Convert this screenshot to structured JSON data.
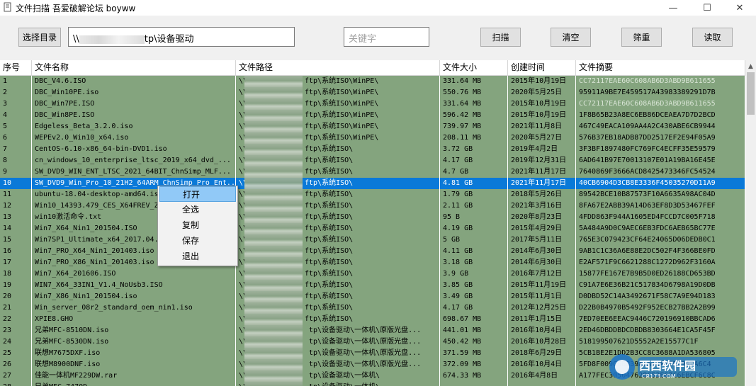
{
  "window": {
    "title": "文件扫描  吾爱破解论坛  boyww",
    "minimize": "—",
    "maximize": "☐",
    "close": "✕"
  },
  "toolbar": {
    "select_dir": "选择目录",
    "path_prefix": "\\\\",
    "path_suffix": "tp\\设备驱动",
    "keyword_placeholder": "关键字",
    "scan": "扫描",
    "clear": "清空",
    "filter": "筛重",
    "read": "读取"
  },
  "table": {
    "headers": [
      "序号",
      "文件名称",
      "文件路径",
      "文件大小",
      "创建时间",
      "文件摘要"
    ],
    "selected_index": 9,
    "rows": [
      [
        "1",
        "DBC_V4.6.ISO",
        "\\\\",
        "ftp\\系统ISO\\WinPE\\",
        "331.64 MB",
        "2015年10月19日",
        "CC72117EAE60C608AB6D3ABD9B611655"
      ],
      [
        "2",
        "DBC_Win10PE.iso",
        "\\\\",
        "ftp\\系统ISO\\WinPE\\",
        "550.76 MB",
        "2020年5月25日",
        "95911A9BE7E459517A43983389291D7B"
      ],
      [
        "3",
        "DBC_Win7PE.ISO",
        "\\\\",
        "ftp\\系统ISO\\WinPE\\",
        "331.64 MB",
        "2015年10月19日",
        "CC72117EAE60C608AB6D3ABD9B611655"
      ],
      [
        "4",
        "DBC_Win8PE.ISO",
        "\\\\",
        "ftp\\系统ISO\\WinPE\\",
        "596.42 MB",
        "2015年10月19日",
        "1F8B65B23A8EC6EB86DCEAEA7D7D2BCD"
      ],
      [
        "5",
        "Edgeless_Beta_3.2.0.iso",
        "\\\\",
        "ftp\\系统ISO\\WinPE\\",
        "739.97 MB",
        "2021年11月8日",
        "467C49EACA109AA4A2C430ABE6CB9944"
      ],
      [
        "6",
        "WEPEv2.0_Win10_x64.iso",
        "\\\\",
        "ftp\\系统ISO\\WinPE\\",
        "208.11 MB",
        "2020年5月27日",
        "576B37EB18ADB87DD2517EF2E94F05A9"
      ],
      [
        "7",
        "CentOS-6.10-x86_64-bin-DVD1.iso",
        "\\\\",
        "ftp\\系统ISO\\",
        "3.72 GB",
        "2019年4月2日",
        "3F3BF1897480FC769FC4ECFF35E59579"
      ],
      [
        "8",
        "cn_windows_10_enterprise_ltsc_2019_x64_dvd_...",
        "\\\\",
        "ftp\\系统ISO\\",
        "4.17 GB",
        "2019年12月31日",
        "6AD641B97E70013107E01A19BA16E45E"
      ],
      [
        "9",
        "SW_DVD9_WIN_ENT_LTSC_2021_64BIT_ChnSimp_MLF...",
        "\\\\",
        "ftp\\系统ISO\\",
        "4.7 GB",
        "2021年11月17日",
        "7640869F3666ACD8425473346FC54524"
      ],
      [
        "10",
        "SW_DVD9_Win_Pro_10_21H2_64ARM_ChnSimp_Pro_Ent...",
        "\\\\",
        "ftp\\系统ISO\\",
        "4.81 GB",
        "2021年11月17日",
        "40CB6904D3CB8E3336F45035270D11A9"
      ],
      [
        "11",
        "ubuntu-18.04-desktop-amd64.iso",
        "\\\\",
        "ftp\\系统ISO\\",
        "1.79 GB",
        "2018年5月26日",
        "89542BCE10B87573F10A6635A98AC04D"
      ],
      [
        "12",
        "Win10_14393.479_CES_X64FREV_ZH-CN.iso",
        "\\\\",
        "ftp\\系统ISO\\",
        "2.11 GB",
        "2021年3月16日",
        "8FA67E2ABB39A14D63EF8D3D53467FEF"
      ],
      [
        "13",
        "win10激活命令.txt",
        "\\\\",
        "ftp\\系统ISO\\",
        "95 B",
        "2020年8月23日",
        "4FDD863F944A1605ED4FCCD7C005F718"
      ],
      [
        "14",
        "Win7_X64_Nin1_201504.ISO",
        "\\\\",
        "ftp\\系统ISO\\",
        "4.19 GB",
        "2015年4月29日",
        "5A484A9D0C9AEC6EB3FDC6AEB65BC77E"
      ],
      [
        "15",
        "Win7SP1_Ultimate_x64_2017.04.iso",
        "\\\\",
        "ftp\\系统ISO\\",
        "5 GB",
        "2017年5月11日",
        "765E3C079423CF64E24065D06DEDB0C1"
      ],
      [
        "16",
        "Win7_PRO_X64_Nin1_201403.iso",
        "\\\\",
        "ftp\\系统ISO\\",
        "4.11 GB",
        "2014年6月30日",
        "9AB1C1C36A6E88E2DC502F4F366BE0FD"
      ],
      [
        "17",
        "Win7_PRO_X86_Nin1_201403.iso",
        "\\\\",
        "ftp\\系统ISO\\",
        "3.18 GB",
        "2014年6月30日",
        "E2AF571F9C6621288C1272D962F3160A"
      ],
      [
        "18",
        "Win7_X64_201606.ISO",
        "\\\\",
        "ftp\\系统ISO\\",
        "3.9 GB",
        "2016年7月12日",
        "15877FE167E7B9B5D0ED26188CD653BD"
      ],
      [
        "19",
        "WIN7_X64_33IN1_V1.4_NoUsb3.ISO",
        "\\\\",
        "ftp\\系统ISO\\",
        "3.85 GB",
        "2015年11月19日",
        "C91A7E6E36B21C517834D6798A19D0DB"
      ],
      [
        "20",
        "Win7_X86_Nin1_201504.iso",
        "\\\\",
        "ftp\\系统ISO\\",
        "3.49 GB",
        "2015年11月1日",
        "D0DBD52C14A3492671F58C7A9E94D183"
      ],
      [
        "21",
        "Win_server_08r2_standard_oem_nin1.iso",
        "\\\\",
        "ftp\\系统ISO\\",
        "4.17 GB",
        "2012年12月25日",
        "D22B0B4970B5492F952ECB27BB2A2B99"
      ],
      [
        "22",
        "XPIE8.GHO",
        "\\\\",
        "ftp\\系统ISO\\",
        "698.67 MB",
        "2011年1月15日",
        "7ED70EE6EEAC9446C720196910BBCAD6"
      ],
      [
        "23",
        "兄弟MFC-8510DN.iso",
        "\\\\",
        "tp\\设备驱动\\一体机\\原版光盘...",
        "441.01 MB",
        "2016年10月4日",
        "2ED46DBDDBDCDBDB8303664E1CA5F45F"
      ],
      [
        "24",
        "兄弟MFC-8530DN.iso",
        "\\\\",
        "tp\\设备驱动\\一体机\\原版光盘...",
        "450.42 MB",
        "2016年10月28日",
        "518199507621D5552A2E15577C1F"
      ],
      [
        "25",
        "联想M7675DXF.iso",
        "\\\\",
        "tp\\设备驱动\\一体机\\原版光盘...",
        "371.59 MB",
        "2018年6月29日",
        "5CB1BE2E1DD2B3CC8C3688A1DA536805"
      ],
      [
        "26",
        "联想M8900DNF.iso",
        "\\\\",
        "tp\\设备驱动\\一体机\\原版光盘...",
        "372.09 MB",
        "2016年10月4日",
        "5FD8F009C6BB39A1A41A5EEC9A7A6C4"
      ],
      [
        "27",
        "佳能一体机MF229DW.rar",
        "\\\\",
        "tp\\设备驱动\\一体机\\",
        "674.33 MB",
        "2016年4月8日",
        "A177FEC305047628C53E67C6EBCF6C8C"
      ],
      [
        "28",
        "兄弟MFC-7470D...",
        "\\\\",
        "tp\\设备驱动\\一体机\\",
        "...",
        "...",
        "..."
      ]
    ]
  },
  "context_menu": {
    "items": [
      "打开",
      "全选",
      "复制",
      "保存",
      "退出"
    ]
  },
  "watermark": {
    "text": "西西软件园",
    "sub": "CR173.COM"
  },
  "colors": {
    "row_bg": "#84a47e",
    "selected_bg": "#0a79d8",
    "menu_highlight": "#91c9f7"
  }
}
